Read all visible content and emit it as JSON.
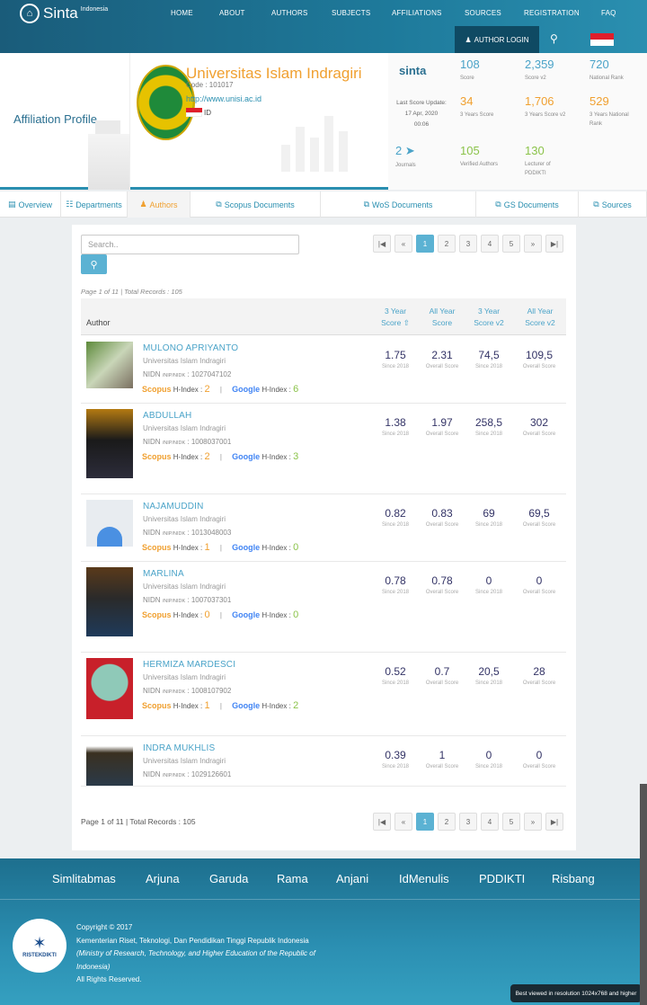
{
  "nav": {
    "brand": "Sinta",
    "brand_sup": "Indonesia",
    "menu": [
      "HOME",
      "ABOUT",
      "AUTHORS",
      "SUBJECTS",
      "AFFILIATIONS",
      "SOURCES",
      "REGISTRATION",
      "FAQ"
    ],
    "login": "AUTHOR LOGIN"
  },
  "profile": {
    "title": "Affiliation Profile",
    "univ_name": "Universitas Islam Indragiri",
    "code": "Code : 101017",
    "url": "http://www.unisi.ac.id",
    "country": "ID",
    "sinta_mini": "sinta",
    "last_update_label": "Last Score Update:",
    "last_update_date": "17 Apr, 2020",
    "last_update_time": "00:06",
    "stats": {
      "score": {
        "v": "108",
        "l": "Score"
      },
      "score_v2": {
        "v": "2,359",
        "l": "Score v2"
      },
      "national_rank": {
        "v": "720",
        "l": "National Rank"
      },
      "score3": {
        "v": "34",
        "l": "3 Years Score"
      },
      "score3_v2": {
        "v": "1,706",
        "l": "3 Years Score v2"
      },
      "national_rank3": {
        "v": "529",
        "l": "3 Years National Rank"
      },
      "journals": {
        "v": "2",
        "l": "Journals"
      },
      "verified": {
        "v": "105",
        "l": "Verified Authors"
      },
      "lecturer": {
        "v": "130",
        "l": "Lecturer of PDDIKTI"
      }
    }
  },
  "tabs": [
    "Overview",
    "Departments",
    "Authors",
    "Scopus Documents",
    "WoS Documents",
    "GS Documents",
    "Sources"
  ],
  "list": {
    "search_placeholder": "Search..",
    "page_info_top": "Page 1 of 11 | Total Records : 105",
    "page_info_bottom": "Page 1 of 11 | Total Records : 105",
    "pages": [
      "1",
      "2",
      "3",
      "4",
      "5"
    ],
    "header": {
      "author": "Author",
      "c1a": "3 Year",
      "c1b": "Score",
      "c2a": "All Year",
      "c2b": "Score",
      "c3a": "3 Year",
      "c3b": "Score v2",
      "c4a": "All Year",
      "c4b": "Score v2"
    },
    "since_label": "Since 2018",
    "overall_label": "Overall Score",
    "scopus_label": "Scopus",
    "google_label": "Google",
    "hindex_label": "H-Index :",
    "inst": "Universitas Islam Indragiri",
    "authors": [
      {
        "name": "MULONO APRIYANTO",
        "nidn": "1027047102",
        "scopus_h": "2",
        "google_h": "6",
        "s3": "1.75",
        "sall": "2.31",
        "v3": "74,5",
        "vall": "109,5"
      },
      {
        "name": "ABDULLAH",
        "nidn": "1008037001",
        "scopus_h": "2",
        "google_h": "3",
        "s3": "1.38",
        "sall": "1.97",
        "v3": "258,5",
        "vall": "302"
      },
      {
        "name": "NAJAMUDDIN",
        "nidn": "1013048003",
        "scopus_h": "1",
        "google_h": "0",
        "s3": "0.82",
        "sall": "0.83",
        "v3": "69",
        "vall": "69,5"
      },
      {
        "name": "MARLINA",
        "nidn": "1007037301",
        "scopus_h": "0",
        "google_h": "0",
        "s3": "0.78",
        "sall": "0.78",
        "v3": "0",
        "vall": "0"
      },
      {
        "name": "HERMIZA MARDESCI",
        "nidn": "1008107902",
        "scopus_h": "1",
        "google_h": "2",
        "s3": "0.52",
        "sall": "0.7",
        "v3": "20,5",
        "vall": "28"
      },
      {
        "name": "INDRA MUKHLIS",
        "nidn": "1029126601",
        "scopus_h": "",
        "google_h": "",
        "s3": "0.39",
        "sall": "1",
        "v3": "0",
        "vall": "0"
      }
    ]
  },
  "footer": {
    "links": [
      "Simlitabmas",
      "Arjuna",
      "Garuda",
      "Rama",
      "Anjani",
      "IdMenulis",
      "PDDIKTI",
      "Risbang"
    ],
    "copyright": "Copyright © 2017",
    "ministry": "Kementerian Riset, Teknologi, Dan Pendidikan Tinggi Republik Indonesia",
    "ministry_en": "(Ministry of Research, Technology, and Higher Education of the Republic of Indonesia)",
    "rights": "All Rights Reserved.",
    "logo_text": "RISTEKDIKTI",
    "best_viewed": "Best viewed in resolution 1024x768 and higher"
  }
}
